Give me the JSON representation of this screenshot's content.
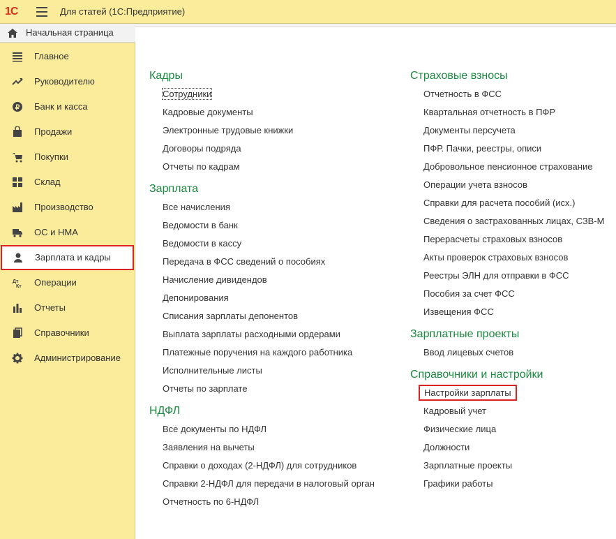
{
  "titlebar": {
    "logo": "1С",
    "title": "Для статей  (1С:Предприятие)"
  },
  "sidebar": {
    "home": "Начальная страница",
    "items": [
      {
        "label": "Главное",
        "icon": "menu-lines-icon"
      },
      {
        "label": "Руководителю",
        "icon": "trend-up-icon"
      },
      {
        "label": "Банк и касса",
        "icon": "coin-icon"
      },
      {
        "label": "Продажи",
        "icon": "bag-icon"
      },
      {
        "label": "Покупки",
        "icon": "cart-icon"
      },
      {
        "label": "Склад",
        "icon": "grid-icon"
      },
      {
        "label": "Производство",
        "icon": "factory-icon"
      },
      {
        "label": "ОС и НМА",
        "icon": "truck-icon"
      },
      {
        "label": "Зарплата и кадры",
        "icon": "person-icon"
      },
      {
        "label": "Операции",
        "icon": "dt-kt-icon"
      },
      {
        "label": "Отчеты",
        "icon": "bar-chart-icon"
      },
      {
        "label": "Справочники",
        "icon": "book-icon"
      },
      {
        "label": "Администрирование",
        "icon": "gear-icon"
      }
    ]
  },
  "main": {
    "left": [
      {
        "title": "Кадры",
        "links": [
          "Сотрудники",
          "Кадровые документы",
          "Электронные трудовые книжки",
          "Договоры подряда",
          "Отчеты по кадрам"
        ]
      },
      {
        "title": "Зарплата",
        "links": [
          "Все начисления",
          "Ведомости в банк",
          "Ведомости в кассу",
          "Передача в ФСС сведений о пособиях",
          "Начисление дивидендов",
          "Депонирования",
          "Списания зарплаты депонентов",
          "Выплата зарплаты расходными ордерами",
          "Платежные поручения на каждого работника",
          "Исполнительные листы",
          "Отчеты по зарплате"
        ]
      },
      {
        "title": "НДФЛ",
        "links": [
          "Все документы по НДФЛ",
          "Заявления на вычеты",
          "Справки о доходах (2-НДФЛ) для сотрудников",
          "Справки 2-НДФЛ для передачи в налоговый орган",
          "Отчетность по 6-НДФЛ"
        ]
      }
    ],
    "right": [
      {
        "title": "Страховые взносы",
        "links": [
          "Отчетность в ФСС",
          "Квартальная отчетность в ПФР",
          "Документы персучета",
          "ПФР. Пачки, реестры, описи",
          "Добровольное пенсионное страхование",
          "Операции учета взносов",
          "Справки для расчета пособий (исх.)",
          "Сведения о застрахованных лицах, СЗВ-М",
          "Перерасчеты страховых взносов",
          "Акты проверок страховых взносов",
          "Реестры ЭЛН для отправки в ФСС",
          "Пособия за счет ФСС",
          "Извещения ФСС"
        ]
      },
      {
        "title": "Зарплатные проекты",
        "links": [
          "Ввод лицевых счетов"
        ]
      },
      {
        "title": "Справочники и настройки",
        "links": [
          "Настройки зарплаты",
          "Кадровый учет",
          "Физические лица",
          "Должности",
          "Зарплатные проекты",
          "Графики работы"
        ]
      }
    ]
  },
  "colors": {
    "section_title": "#1a8a3e",
    "highlight_border": "#d22222",
    "sidebar_bg": "#fbec9c"
  }
}
